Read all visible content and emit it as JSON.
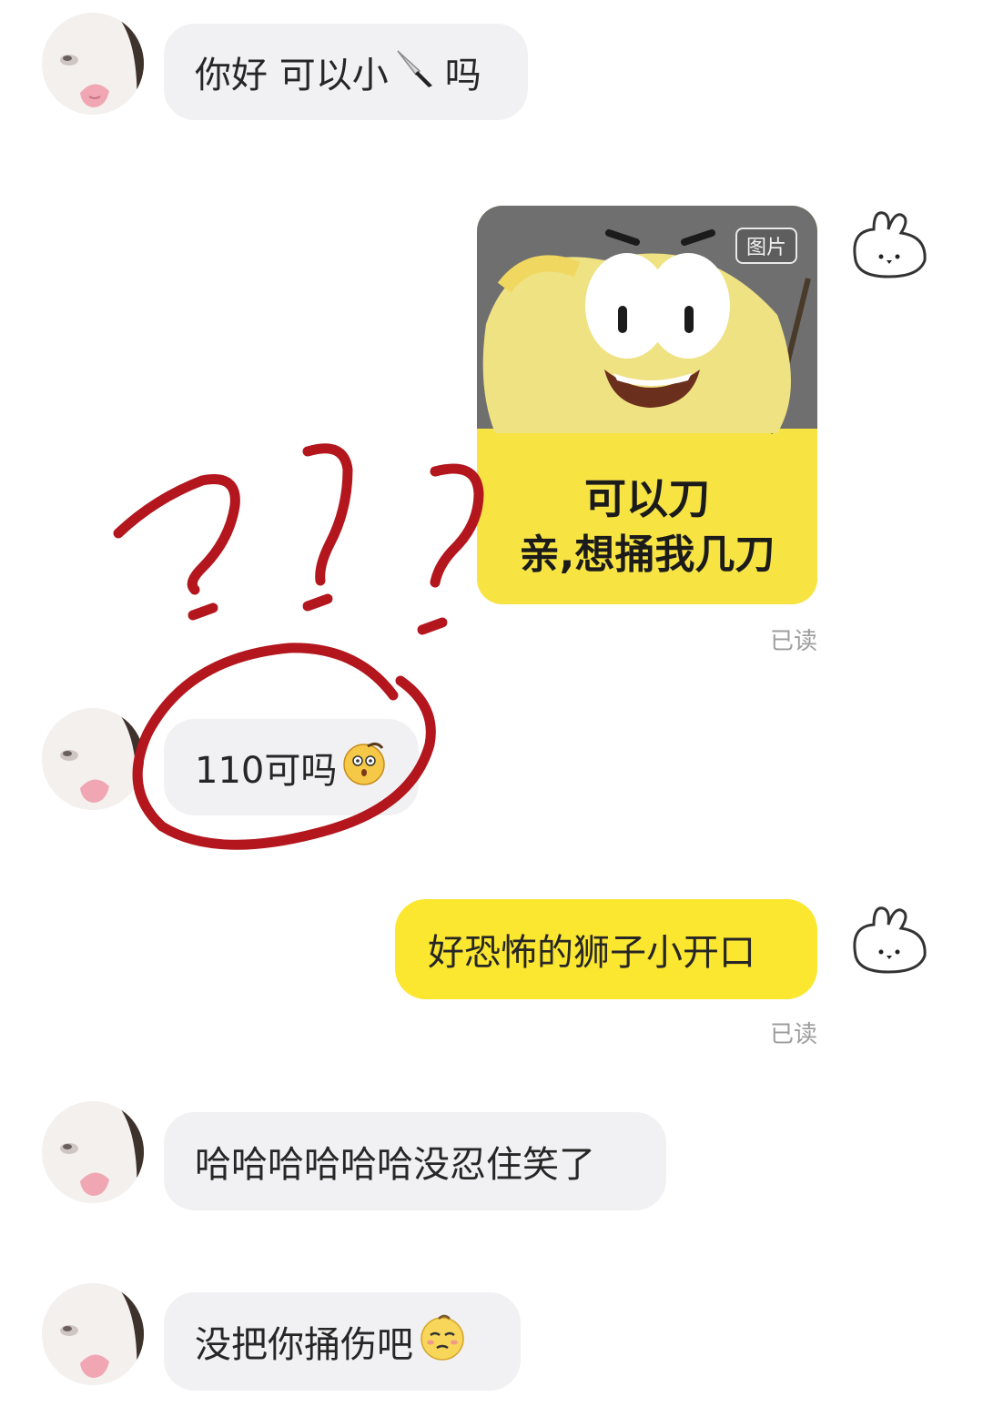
{
  "messages": [
    {
      "text": "你好 可以小",
      "suffix": "吗"
    },
    {
      "sticker": {
        "tag": "图片",
        "caption_line1": "可以刀",
        "caption_line2": "亲,想捅我几刀"
      },
      "status": "已读"
    },
    {
      "text": "110可吗"
    },
    {
      "text": "好恐怖的狮子小开口",
      "status": "已读"
    },
    {
      "text": "哈哈哈哈哈哈没忍住笑了"
    },
    {
      "text": "没把你捅伤吧"
    }
  ],
  "icons": {
    "knife": "knife-icon",
    "shocked": "shocked-emoji-icon",
    "sheepish": "sheepish-emoji-icon",
    "avatar_self": "bunny-avatar",
    "avatar_other": "cat-avatar"
  },
  "colors": {
    "incoming_bubble": "#f1f1f3",
    "outgoing_bubble": "#fbe630",
    "annotation_red": "#b3161d"
  }
}
